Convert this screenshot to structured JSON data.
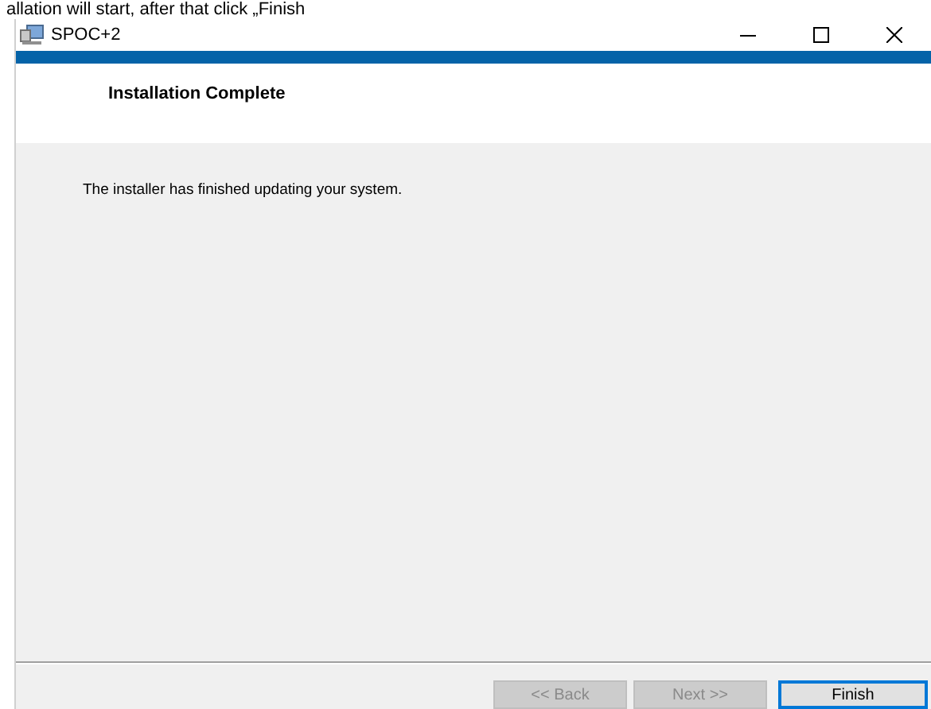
{
  "caption": "allation will start, after that click „Finish",
  "window": {
    "title": "SPOC+2"
  },
  "header": {
    "title": "Installation Complete"
  },
  "message": "The installer has finished updating your system.",
  "buttons": [
    {
      "label": "<< Back",
      "disabled": true,
      "default": false
    },
    {
      "label": "Next >>",
      "disabled": true,
      "default": false
    },
    {
      "label": "Finish",
      "disabled": false,
      "default": true
    }
  ]
}
